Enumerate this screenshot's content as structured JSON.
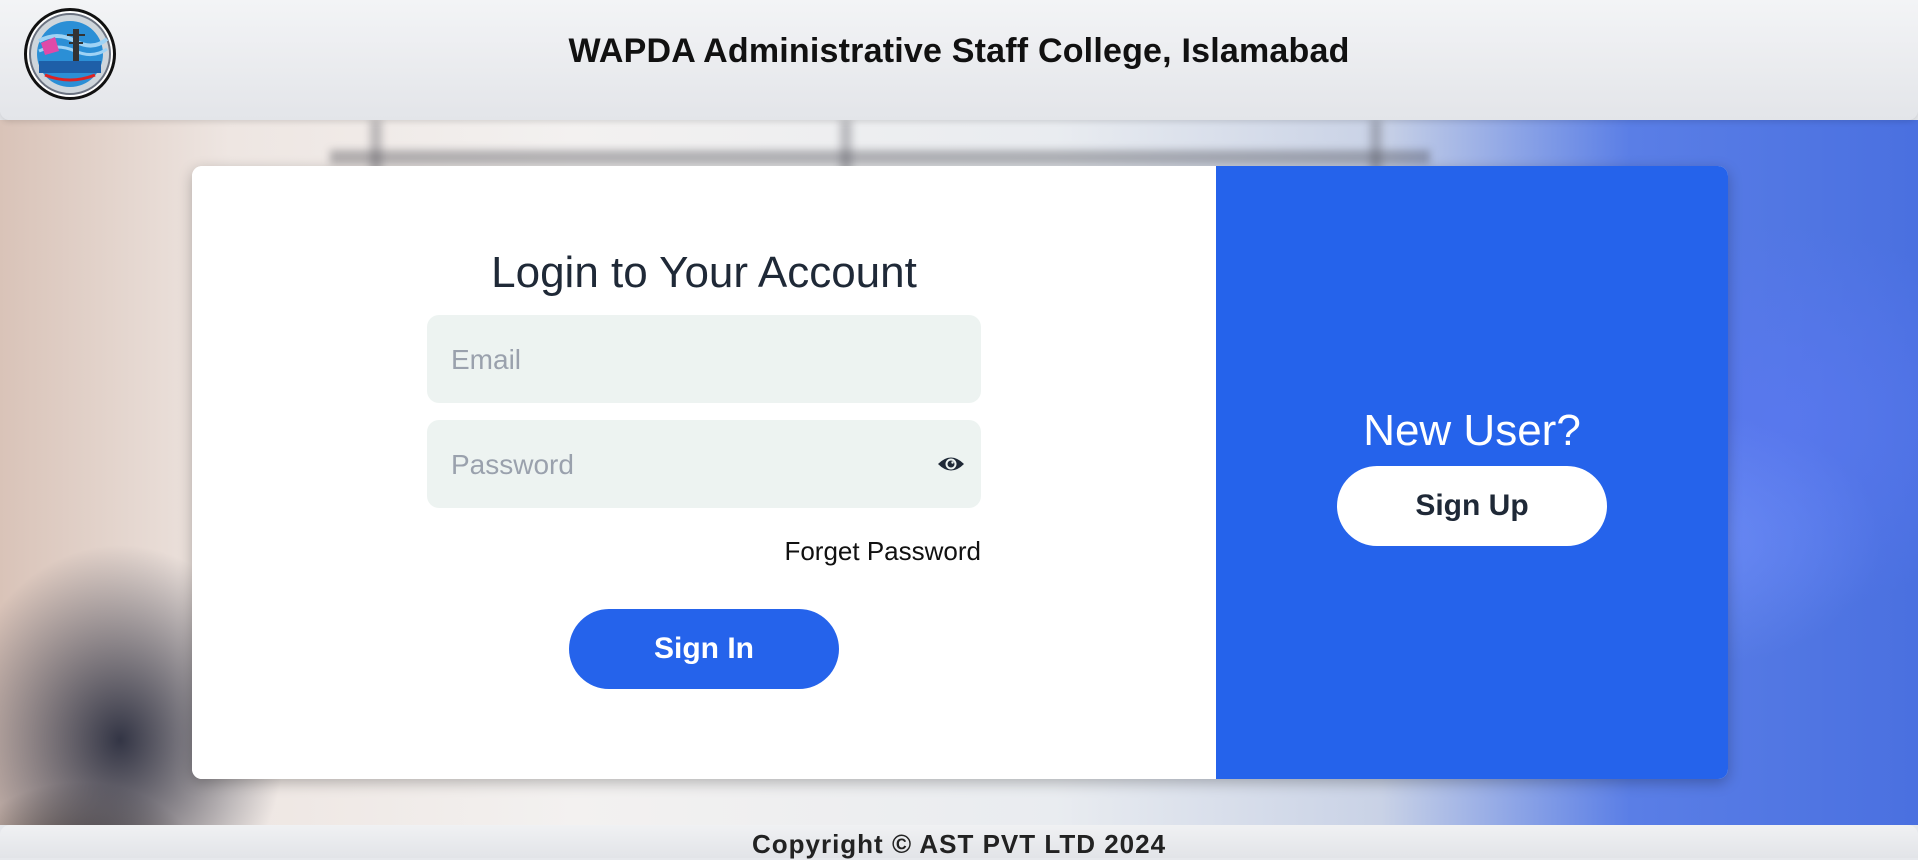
{
  "header": {
    "title": "WAPDA Administrative Staff College, Islamabad",
    "logo_icon": "college-emblem-icon"
  },
  "login": {
    "title": "Login to Your Account",
    "email_placeholder": "Email",
    "email_value": "",
    "password_placeholder": "Password",
    "password_value": "",
    "password_toggle_icon": "eye-icon",
    "forget_label": "Forget Password",
    "signin_label": "Sign In"
  },
  "signup_panel": {
    "prompt": "New User?",
    "signup_label": "Sign Up"
  },
  "footer": {
    "copyright": "Copyright © AST PVT LTD 2024"
  },
  "colors": {
    "accent": "#2563eb",
    "input_bg": "#edf3f1"
  }
}
